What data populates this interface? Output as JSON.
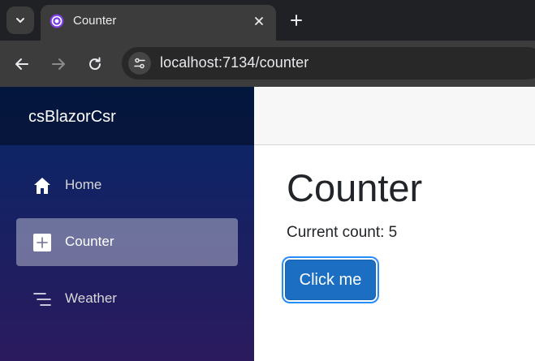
{
  "browser": {
    "tab": {
      "title": "Counter"
    },
    "address_bar": {
      "url": "localhost:7134/counter"
    }
  },
  "app": {
    "brand": "csBlazorCsr",
    "nav": [
      {
        "label": "Home",
        "icon": "home-icon",
        "active": false
      },
      {
        "label": "Counter",
        "icon": "plus-square-icon",
        "active": true
      },
      {
        "label": "Weather",
        "icon": "list-icon",
        "active": false
      }
    ],
    "page": {
      "title": "Counter",
      "count_text": "Current count: 5",
      "count_value": 5,
      "button_label": "Click me"
    }
  },
  "colors": {
    "sidebar_top": "#052767",
    "sidebar_bottom": "#2b1a5e",
    "button": "#1b6ec2",
    "focus_ring": "#258cfb"
  }
}
